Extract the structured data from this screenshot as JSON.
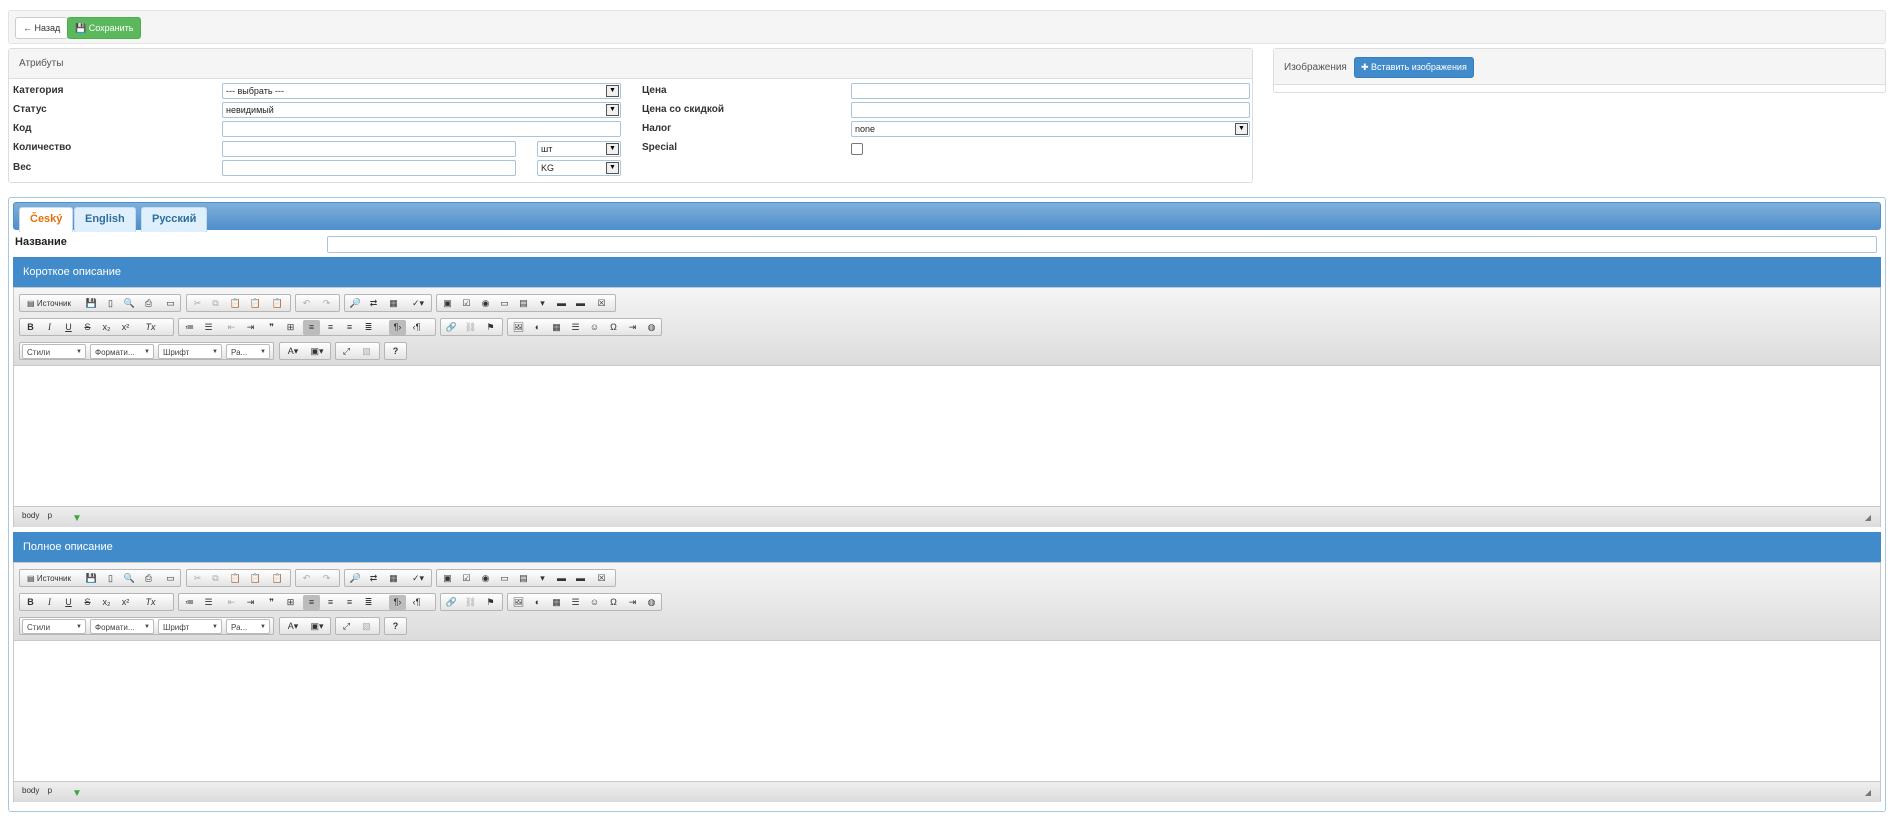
{
  "toolbar": {
    "back_label": "← Назад",
    "save_label": "💾 Сохранить"
  },
  "attributes": {
    "title": "Атрибуты",
    "category_label": "Категория",
    "category_value": "--- выбрать ---",
    "status_label": "Статус",
    "status_value": "невидимый",
    "code_label": "Код",
    "code_value": "",
    "quantity_label": "Количество",
    "quantity_value": "",
    "unit_value": "шт",
    "weight_label": "Вес",
    "weight_value": "",
    "weight_unit_value": "KG",
    "price_label": "Цена",
    "price_value": "",
    "discount_label": "Цена со скидкой",
    "discount_value": "",
    "tax_label": "Налог",
    "tax_value": "none",
    "special_label": "Special"
  },
  "images": {
    "title": "Изображения",
    "insert_label": "✚ Вставить изображения"
  },
  "tabs": [
    {
      "label": "Český"
    },
    {
      "label": "English"
    },
    {
      "label": "Русский"
    }
  ],
  "name_label": "Название",
  "editors": {
    "short_title": "Короткое описание",
    "full_title": "Полное описание",
    "source_label": "Источник",
    "combo_styles": "Стили",
    "combo_format": "Формати...",
    "combo_font": "Шрифт",
    "combo_size": "Ра...",
    "status_body": "body",
    "status_p": "p"
  }
}
